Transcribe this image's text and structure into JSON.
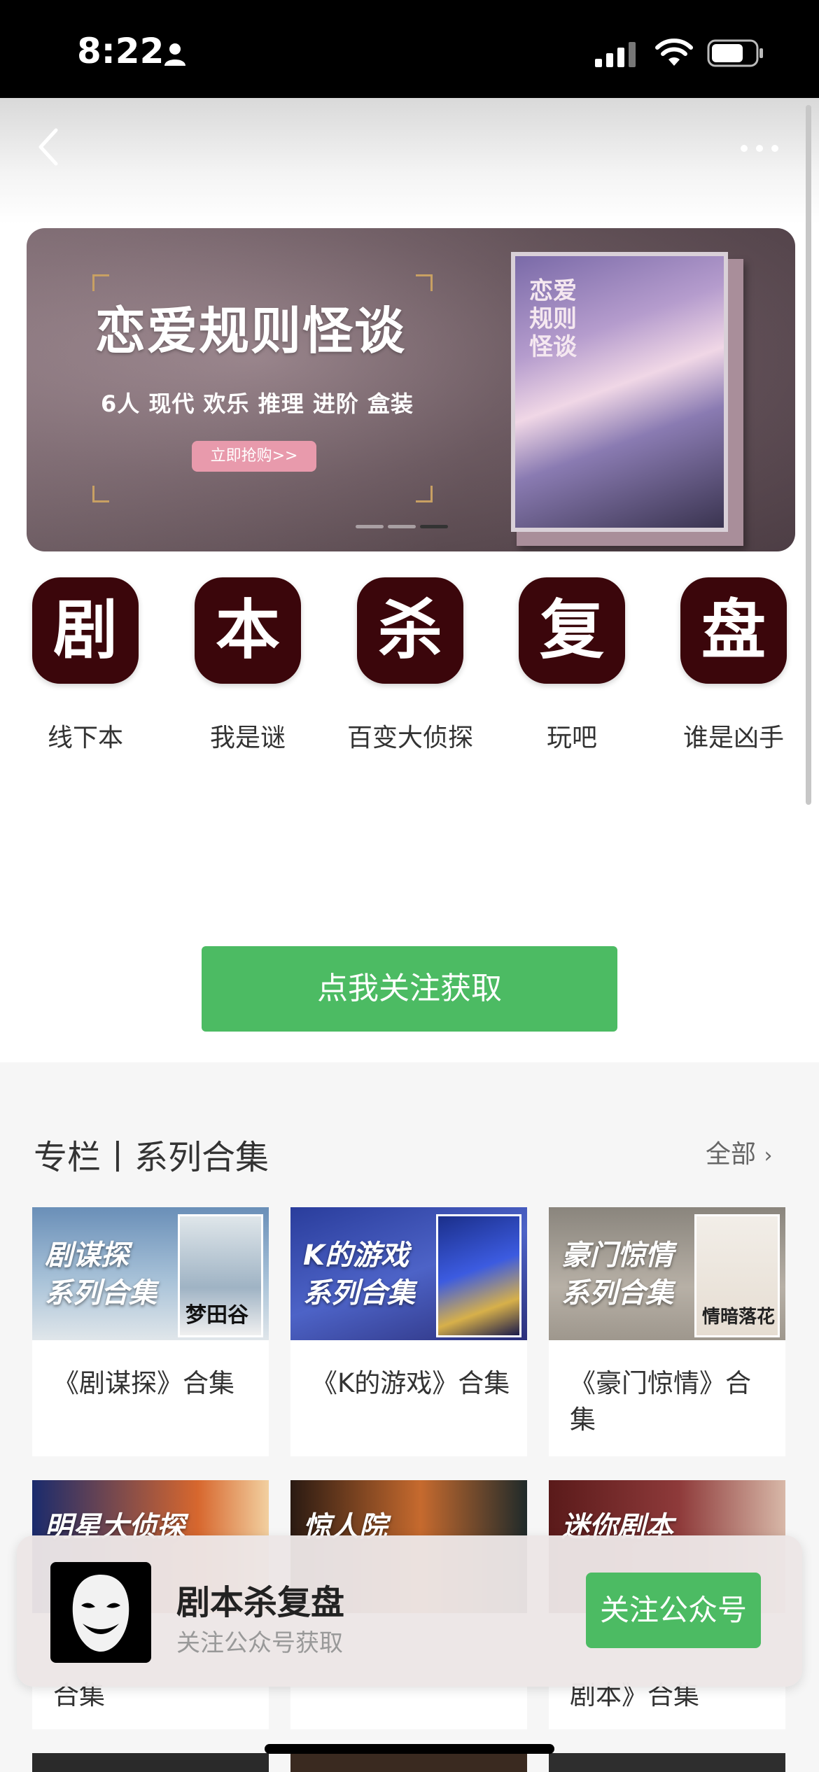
{
  "status_bar": {
    "time": "8:22"
  },
  "banner": {
    "title": "恋爱规则怪谈",
    "subtitle": "6人 现代 欢乐 推理 进阶 盒装",
    "button_label": "立即抢购>>",
    "book_title": "恋爱规则怪谈"
  },
  "categories": [
    {
      "icon_char": "剧",
      "label": "线下本"
    },
    {
      "icon_char": "本",
      "label": "我是谜"
    },
    {
      "icon_char": "杀",
      "label": "百变大侦探"
    },
    {
      "icon_char": "复",
      "label": "玩吧"
    },
    {
      "icon_char": "盘",
      "label": "谁是凶手"
    }
  ],
  "follow_button": "点我关注获取",
  "section": {
    "title": "专栏丨系列合集",
    "see_all": "全部",
    "cards": [
      {
        "img_text_1": "剧谋探",
        "img_text_2": "系列合集",
        "book_text": "梦田谷",
        "caption": "《剧谋探》合集"
      },
      {
        "img_text_1": "K的游戏",
        "img_text_2": "系列合集",
        "caption": "《K的游戏》合集"
      },
      {
        "img_text_1": "豪门惊情",
        "img_text_2": "系列合集",
        "book_text": "情暗落花",
        "caption": "《豪门惊情》合集"
      },
      {
        "img_text_1": "明星大侦探",
        "caption": "合集"
      },
      {
        "img_text_1": "惊人院",
        "caption": ""
      },
      {
        "img_text_1": "迷你剧本",
        "caption": "剧本》合集"
      }
    ]
  },
  "float_bar": {
    "name": "剧本杀复盘",
    "subtitle": "关注公众号获取",
    "button": "关注公众号"
  },
  "colors": {
    "accent_green": "#4cbb63",
    "category_icon_bg": "#3b060b"
  }
}
